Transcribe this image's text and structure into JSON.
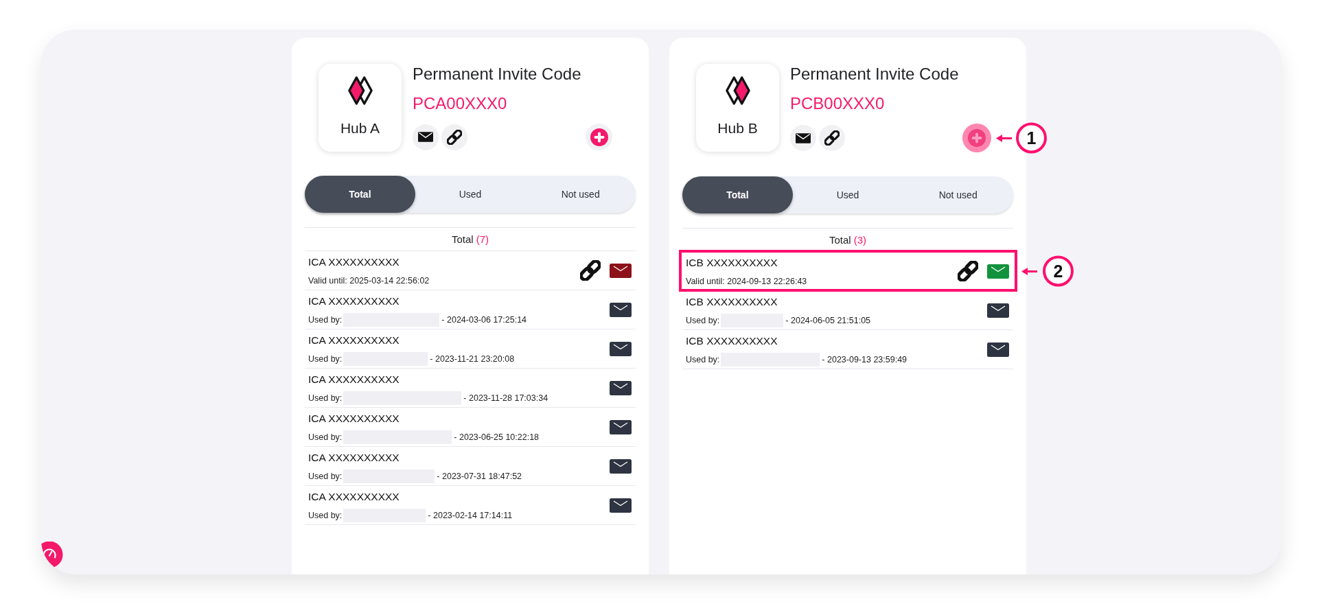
{
  "hubs": [
    {
      "name": "Hub A",
      "logo_mirrored": false,
      "title": "Permanent Invite Code",
      "code": "PCA00XXX0",
      "add_button": {
        "highlighted": false
      },
      "tabs": [
        {
          "label": "Total",
          "selected": true
        },
        {
          "label": "Used",
          "selected": false
        },
        {
          "label": "Not used",
          "selected": false
        }
      ],
      "list_title": "Total",
      "list_count": "(7)",
      "invites": [
        {
          "kind": "valid",
          "code": "ICA XXXXXXXXXX",
          "detail": "Valid until: 2025-03-14 22:56:02",
          "color": "#8c1119",
          "highlighted": false
        },
        {
          "kind": "used",
          "code": "ICA XXXXXXXXXX",
          "label": "Used by:",
          "date": "- 2024-03-06 17:25:14",
          "color": "#2e3441",
          "highlighted": false
        },
        {
          "kind": "used",
          "code": "ICA XXXXXXXXXX",
          "label": "Used by:",
          "date": "- 2023-11-21 23:20:08",
          "color": "#2e3441",
          "highlighted": false
        },
        {
          "kind": "used",
          "code": "ICA XXXXXXXXXX",
          "label": "Used by:",
          "date": "- 2023-11-28 17:03:34",
          "color": "#2e3441",
          "highlighted": false
        },
        {
          "kind": "used",
          "code": "ICA XXXXXXXXXX",
          "label": "Used by:",
          "date": "- 2023-06-25 10:22:18",
          "color": "#2e3441",
          "highlighted": false
        },
        {
          "kind": "used",
          "code": "ICA XXXXXXXXXX",
          "label": "Used by:",
          "date": "- 2023-07-31 18:47:52",
          "color": "#2e3441",
          "highlighted": false
        },
        {
          "kind": "used",
          "code": "ICA XXXXXXXXXX",
          "label": "Used by:",
          "date": "- 2023-02-14 17:14:11",
          "color": "#2e3441",
          "highlighted": false
        }
      ]
    },
    {
      "name": "Hub B",
      "logo_mirrored": true,
      "title": "Permanent Invite Code",
      "code": "PCB00XXX0",
      "add_button": {
        "highlighted": true,
        "callout": "1"
      },
      "tabs": [
        {
          "label": "Total",
          "selected": true
        },
        {
          "label": "Used",
          "selected": false
        },
        {
          "label": "Not used",
          "selected": false
        }
      ],
      "list_title": "Total",
      "list_count": "(3)",
      "invites": [
        {
          "kind": "valid",
          "code": "ICB XXXXXXXXXX",
          "detail": "Valid until: 2024-09-13 22:26:43",
          "color": "#13923d",
          "highlighted": true,
          "callout": "2"
        },
        {
          "kind": "used",
          "code": "ICB XXXXXXXXXX",
          "label": "Used by:",
          "date": "- 2024-06-05 21:51:05",
          "color": "#2e3441",
          "highlighted": false
        },
        {
          "kind": "used",
          "code": "ICB XXXXXXXXXX",
          "label": "Used by:",
          "date": "- 2023-09-13 23:59:49",
          "color": "#2e3441",
          "highlighted": false
        }
      ]
    }
  ]
}
